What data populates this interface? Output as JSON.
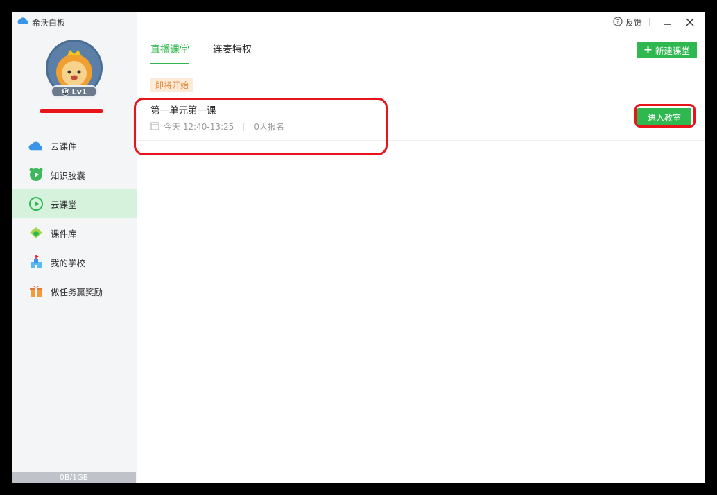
{
  "app": {
    "title": "希沃白板"
  },
  "user": {
    "level": "Lv1",
    "level_icon_text": "EN"
  },
  "sidebar": {
    "items": [
      {
        "label": "云课件",
        "icon": "cloud-icon"
      },
      {
        "label": "知识胶囊",
        "icon": "capsule-icon"
      },
      {
        "label": "云课堂",
        "icon": "play-circle-icon",
        "active": true
      },
      {
        "label": "课件库",
        "icon": "library-icon"
      },
      {
        "label": "我的学校",
        "icon": "school-icon"
      },
      {
        "label": "做任务赢奖励",
        "icon": "gift-icon"
      }
    ],
    "storage": "0B/1GB"
  },
  "titlebar": {
    "feedback_label": "反馈"
  },
  "tabs": [
    {
      "label": "直播课堂",
      "active": true
    },
    {
      "label": "连麦特权",
      "active": false
    }
  ],
  "toolbar": {
    "new_class_label": "新建课堂"
  },
  "course": {
    "status": "即将开始",
    "title": "第一单元第一课",
    "time": "今天 12:40-13:25",
    "signups": "0人报名",
    "enter_label": "进入教室"
  },
  "colors": {
    "accent": "#2eb84f",
    "highlight": "#e8141c",
    "tag_bg": "#fdebd8",
    "tag_text": "#e38a3c"
  }
}
